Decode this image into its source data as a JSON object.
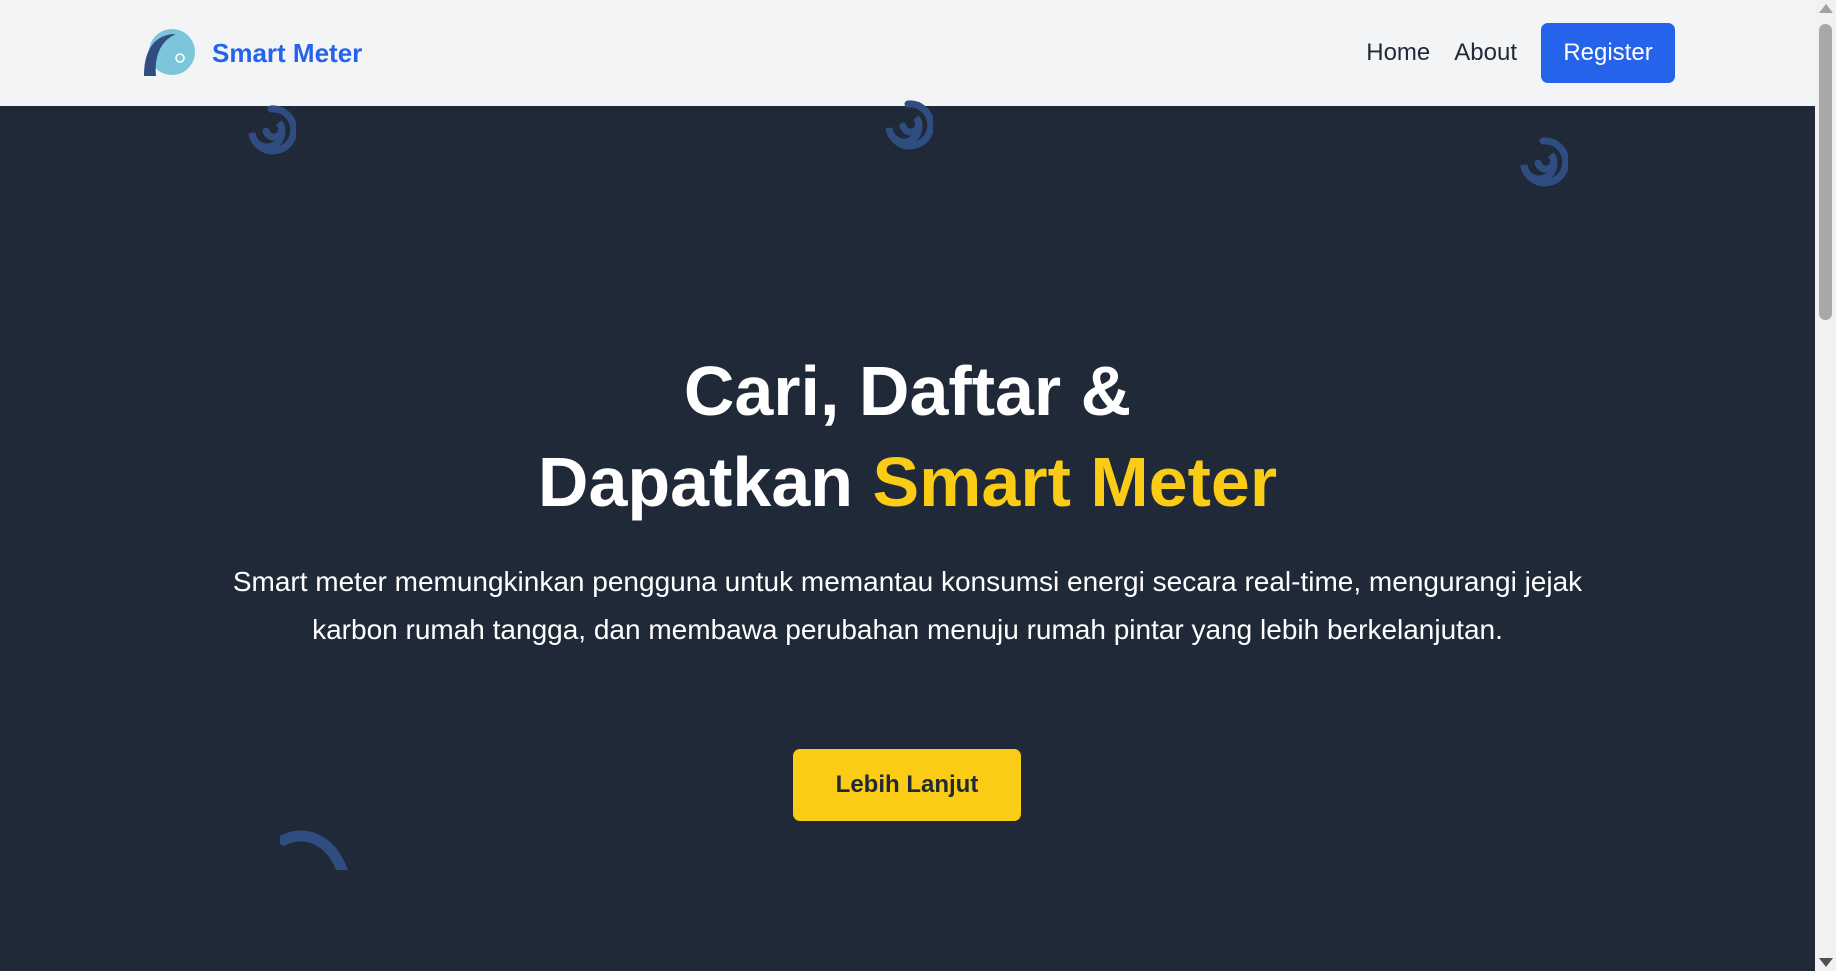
{
  "nav": {
    "brand": "Smart Meter",
    "links": [
      {
        "label": "Home"
      },
      {
        "label": "About"
      }
    ],
    "register_label": "Register"
  },
  "hero": {
    "title_line1": "Cari, Daftar &",
    "title_line2_prefix": "Dapatkan ",
    "title_line2_highlight": "Smart Meter",
    "description": "Smart meter memungkinkan pengguna untuk memantau konsumsi energi secara real-time, mengurangi jejak karbon rumah tangga, dan membawa perubahan menuju rumah pintar yang lebih berkelanjutan.",
    "cta_label": "Lebih Lanjut"
  },
  "icons": {
    "logo": "wave-logo-icon",
    "decor": "swirl-icon"
  },
  "colors": {
    "navbar_bg": "#f3f4f6",
    "hero_bg": "#1f2937",
    "brand_blue": "#2563eb",
    "accent_yellow": "#facc15",
    "swirl_blue": "#2f4d80"
  }
}
